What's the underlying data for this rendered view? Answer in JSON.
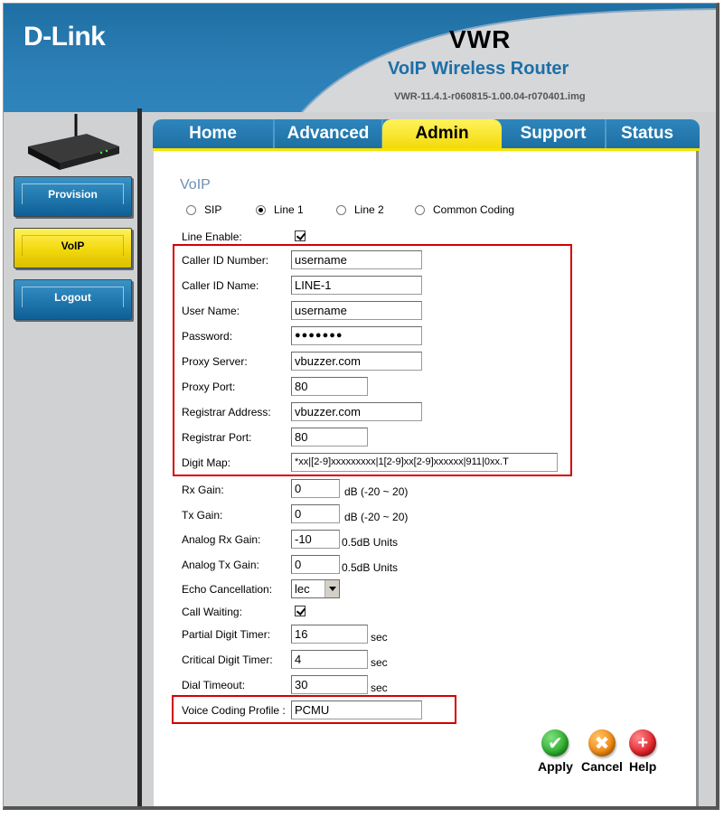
{
  "header": {
    "brand": "D-Link",
    "product_code": "VWR",
    "product_name": "VoIP Wireless Router",
    "firmware": "VWR-11.4.1-r060815-1.00.04-r070401.img"
  },
  "sidebar": {
    "items": [
      {
        "label": "Provision",
        "active": false
      },
      {
        "label": "VoIP",
        "active": true
      },
      {
        "label": "Logout",
        "active": false
      }
    ]
  },
  "tabs": [
    {
      "label": "Home",
      "active": false
    },
    {
      "label": "Advanced",
      "active": false
    },
    {
      "label": "Admin",
      "active": true
    },
    {
      "label": "Support",
      "active": false
    },
    {
      "label": "Status",
      "active": false
    }
  ],
  "section": {
    "title": "VoIP",
    "radios": [
      {
        "label": "SIP",
        "selected": false
      },
      {
        "label": "Line 1",
        "selected": true
      },
      {
        "label": "Line 2",
        "selected": false
      },
      {
        "label": "Common Coding",
        "selected": false
      }
    ]
  },
  "form": {
    "line_enable": {
      "label": "Line Enable:",
      "checked": true
    },
    "caller_id_number": {
      "label": "Caller ID Number:",
      "value": "username"
    },
    "caller_id_name": {
      "label": "Caller ID Name:",
      "value": "LINE-1"
    },
    "user_name": {
      "label": "User Name:",
      "value": "username"
    },
    "password": {
      "label": "Password:",
      "value": "●●●●●●●"
    },
    "proxy_server": {
      "label": "Proxy Server:",
      "value": "vbuzzer.com"
    },
    "proxy_port": {
      "label": "Proxy Port:",
      "value": "80"
    },
    "registrar_address": {
      "label": "Registrar Address:",
      "value": "vbuzzer.com"
    },
    "registrar_port": {
      "label": "Registrar Port:",
      "value": "80"
    },
    "digit_map": {
      "label": "Digit Map:",
      "value": "*xx|[2-9]xxxxxxxxx|1[2-9]xx[2-9]xxxxxx|911|0xx.T"
    },
    "rx_gain": {
      "label": "Rx Gain:",
      "value": "0",
      "unit": "dB (-20 ~ 20)"
    },
    "tx_gain": {
      "label": "Tx Gain:",
      "value": "0",
      "unit": "dB (-20 ~ 20)"
    },
    "analog_rx_gain": {
      "label": "Analog Rx Gain:",
      "value": "-10",
      "unit": "0.5dB Units"
    },
    "analog_tx_gain": {
      "label": "Analog Tx Gain:",
      "value": "0",
      "unit": "0.5dB Units"
    },
    "echo_cancellation": {
      "label": "Echo Cancellation:",
      "value": "lec"
    },
    "call_waiting": {
      "label": "Call Waiting:",
      "checked": true
    },
    "partial_digit_timer": {
      "label": "Partial Digit Timer:",
      "value": "16",
      "unit": "sec"
    },
    "critical_digit_timer": {
      "label": "Critical Digit Timer:",
      "value": "4",
      "unit": "sec"
    },
    "dial_timeout": {
      "label": "Dial Timeout:",
      "value": "30",
      "unit": "sec"
    },
    "voice_coding_profile": {
      "label": "Voice Coding Profile :",
      "value": "PCMU"
    }
  },
  "actions": {
    "apply": "Apply",
    "cancel": "Cancel",
    "help": "Help"
  },
  "colors": {
    "brand_blue": "#1f6fa3",
    "active_yellow": "#f3da0a",
    "highlight_red": "#d40000",
    "apply_green": "#2fae2f",
    "cancel_orange": "#f08a12",
    "help_red": "#e2242a"
  }
}
